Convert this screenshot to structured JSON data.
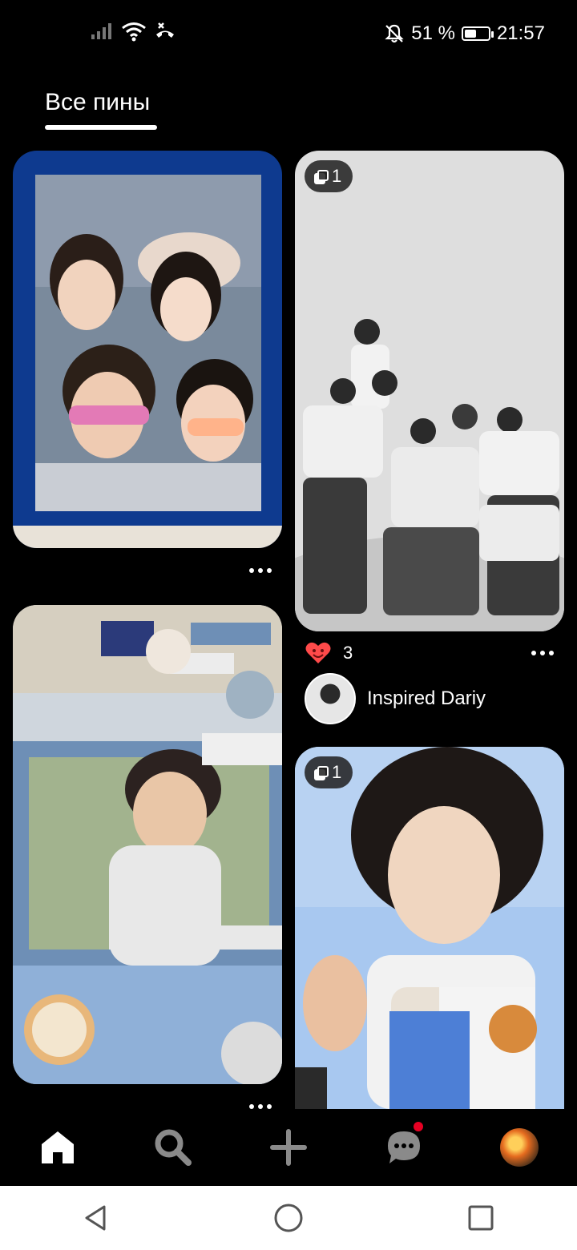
{
  "status_bar": {
    "battery_percent": "51 %",
    "time": "21:57",
    "battery_level": 0.51
  },
  "header": {
    "tab_label": "Все пины"
  },
  "feed": {
    "pins": [
      {
        "id": "pin-left-1",
        "image_desc": "photo booth strip",
        "image_colors": [
          "#0e3a8f",
          "#7a8a9c",
          "#e8e2d8"
        ],
        "has_more": true
      },
      {
        "id": "pin-right-1",
        "image_desc": "group photo black and white",
        "badge_count": "1",
        "image_colors": [
          "#dedede",
          "#b8b8b8",
          "#3a3a3a"
        ],
        "reaction_count": "3",
        "author_name": "Inspired Dariy",
        "has_more": true
      },
      {
        "id": "pin-left-2",
        "image_desc": "collage",
        "image_colors": [
          "#cfd6dd",
          "#6e8fb6",
          "#2c2c2c"
        ],
        "has_more": true
      },
      {
        "id": "pin-right-2",
        "image_desc": "portrait",
        "badge_count": "1",
        "image_colors": [
          "#a8c8f0",
          "#f0d6c0",
          "#2a2a2a"
        ]
      }
    ]
  },
  "bottom_nav": {
    "items": [
      {
        "name": "home",
        "active": true
      },
      {
        "name": "search",
        "active": false
      },
      {
        "name": "create",
        "active": false
      },
      {
        "name": "messages",
        "active": false,
        "has_notification": true
      },
      {
        "name": "profile",
        "active": false
      }
    ]
  },
  "colors": {
    "background": "#000000",
    "text": "#ffffff",
    "inactive_icon": "#8a8a8a",
    "notification": "#e60023",
    "heart": "#ff4a4a"
  }
}
